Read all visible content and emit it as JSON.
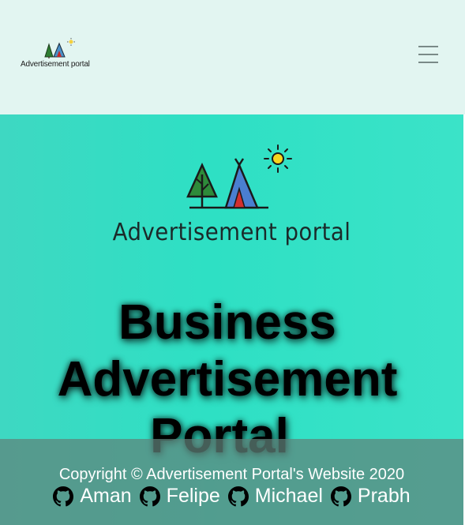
{
  "navbar": {
    "logo_text": "Advertisement portal",
    "menu_icon": "hamburger-menu-icon"
  },
  "hero": {
    "logo_text": "Advertisement portal",
    "title_lines": [
      "Business",
      "Advertisement",
      "Portal"
    ]
  },
  "footer": {
    "copyright": "Copyright © Advertisement Portal's Website 2020",
    "contributors": [
      {
        "name": "Aman",
        "icon": "github-icon"
      },
      {
        "name": "Felipe",
        "icon": "github-icon"
      },
      {
        "name": "Michael",
        "icon": "github-icon"
      },
      {
        "name": "Prabh",
        "icon": "github-icon"
      }
    ]
  },
  "colors": {
    "navbar_bg": "#e2f5f1",
    "hero_bg": "#2ee0c4",
    "footer_bg": "#5f827a",
    "title_text": "#000000"
  }
}
